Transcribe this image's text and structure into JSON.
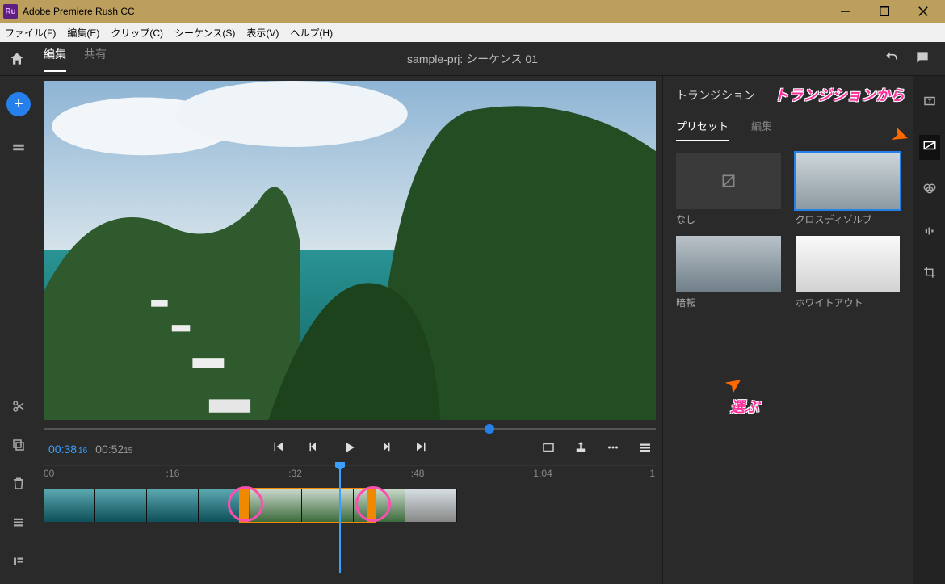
{
  "titlebar": {
    "appName": "Adobe Premiere Rush CC",
    "iconText": "Ru"
  },
  "menubar": {
    "file": "ファイル(F)",
    "edit": "編集(E)",
    "clip": "クリップ(C)",
    "sequence": "シーケンス(S)",
    "view": "表示(V)",
    "help": "ヘルプ(H)"
  },
  "appbar": {
    "tabEdit": "編集",
    "tabShare": "共有",
    "projectTitle": "sample-prj:  シーケンス 01"
  },
  "transport": {
    "currentTime": "00:38",
    "currentFrames": "16",
    "duration": "00:52",
    "durationFrames": "15"
  },
  "ruler": {
    "t0": "00",
    "t1": ":16",
    "t2": ":32",
    "t3": ":48",
    "t4": "1:04",
    "t5": "1"
  },
  "panel": {
    "title": "トランジション",
    "tabPresets": "プリセット",
    "tabEdit": "編集",
    "presets": {
      "none": "なし",
      "crossDissolve": "クロスディゾルブ",
      "dipBlack": "暗転",
      "dipWhite": "ホワイトアウト"
    }
  },
  "annotations": {
    "fromTransitions": "トランジションから",
    "choose": "選ぶ"
  }
}
